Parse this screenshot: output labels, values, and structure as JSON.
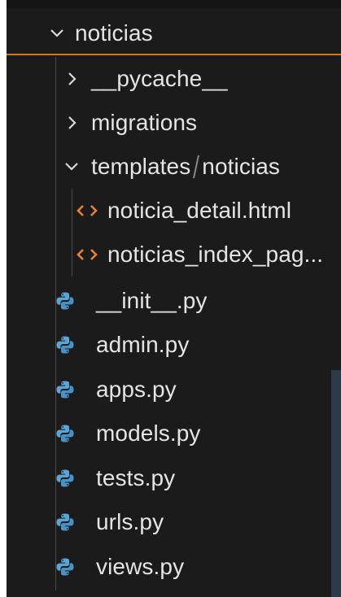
{
  "explorer": {
    "root_folder": {
      "label": "noticias",
      "expanded": true
    },
    "folders": [
      {
        "label": "__pycache__",
        "expanded": false
      },
      {
        "label": "migrations",
        "expanded": false
      }
    ],
    "templates_folder": {
      "label_part1": "templates",
      "label_part2": "noticias",
      "expanded": true,
      "files": [
        {
          "label": "noticia_detail.html",
          "icon": "html-icon"
        },
        {
          "label": "noticias_index_pag...",
          "icon": "html-icon"
        }
      ]
    },
    "py_files": [
      {
        "label": "__init__.py",
        "icon": "python-icon"
      },
      {
        "label": "admin.py",
        "icon": "python-icon"
      },
      {
        "label": "apps.py",
        "icon": "python-icon"
      },
      {
        "label": "models.py",
        "icon": "python-icon"
      },
      {
        "label": "tests.py",
        "icon": "python-icon"
      },
      {
        "label": "urls.py",
        "icon": "python-icon"
      },
      {
        "label": "views.py",
        "icon": "python-icon"
      }
    ],
    "colors": {
      "background": "#1b1b1b",
      "accent_border": "#c87a2c",
      "html_icon": "#e8803a",
      "python_icon": "#5aa5d8",
      "text": "#e4e4e4"
    }
  }
}
